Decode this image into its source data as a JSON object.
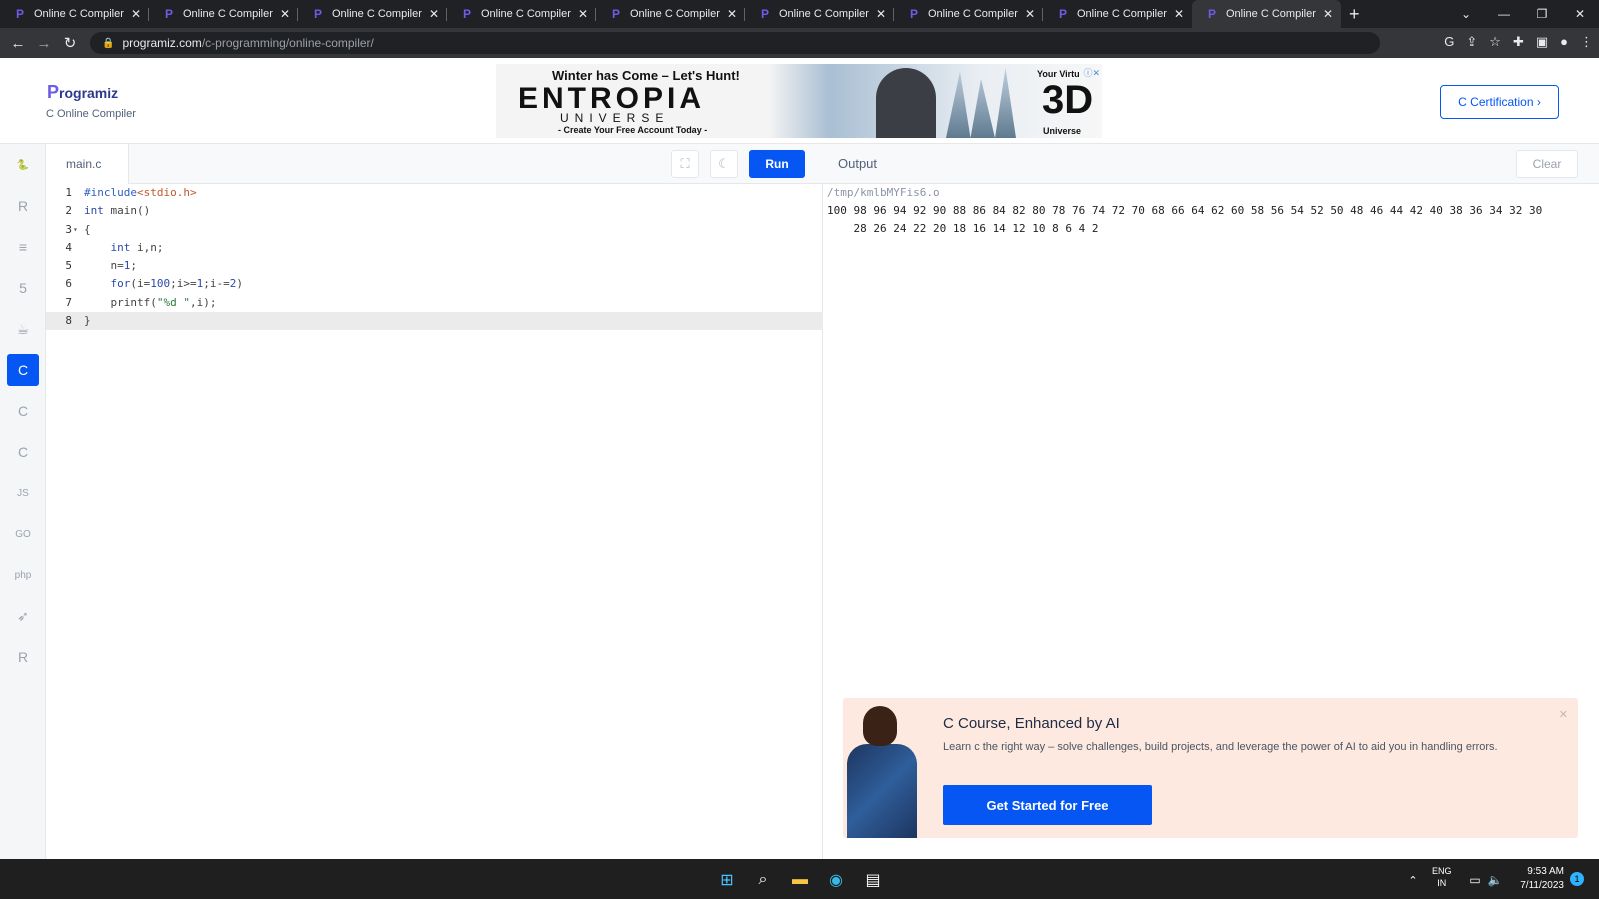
{
  "browser": {
    "tabs": [
      {
        "title": "Online C Compiler"
      },
      {
        "title": "Online C Compiler"
      },
      {
        "title": "Online C Compiler"
      },
      {
        "title": "Online C Compiler"
      },
      {
        "title": "Online C Compiler"
      },
      {
        "title": "Online C Compiler"
      },
      {
        "title": "Online C Compiler"
      },
      {
        "title": "Online C Compiler"
      },
      {
        "title": "Online C Compiler",
        "active": true
      }
    ],
    "url_host": "programiz.com",
    "url_path": "/c-programming/online-compiler/"
  },
  "header": {
    "logo": "rogramiz",
    "logo_initial": "P",
    "subtitle": "C Online Compiler",
    "cert_button": "C Certification ›"
  },
  "ad": {
    "line1": "Winter has Come – Let's Hunt!",
    "brand": "ENTROPIA",
    "brand_sub": "UNIVERSE",
    "cta": "- Create Your Free Account Today -",
    "right_top": "Your Virtu",
    "right_big": "3D",
    "right_bottom": "Universe"
  },
  "sidebar": {
    "languages": [
      {
        "icon": "python-icon",
        "glyph": "🐍",
        "active": false
      },
      {
        "icon": "r-icon",
        "glyph": "R",
        "active": false
      },
      {
        "icon": "sql-icon",
        "glyph": "≡",
        "active": false
      },
      {
        "icon": "html-icon",
        "glyph": "5",
        "active": false
      },
      {
        "icon": "java-icon",
        "glyph": "☕",
        "active": false
      },
      {
        "icon": "c-icon",
        "glyph": "C",
        "active": true
      },
      {
        "icon": "cpp-icon",
        "glyph": "C",
        "active": false
      },
      {
        "icon": "csharp-icon",
        "glyph": "C",
        "active": false
      },
      {
        "icon": "js-icon",
        "glyph": "JS",
        "active": false
      },
      {
        "icon": "go-icon",
        "glyph": "GO",
        "active": false
      },
      {
        "icon": "php-icon",
        "glyph": "php",
        "active": false
      },
      {
        "icon": "swift-icon",
        "glyph": "➶",
        "active": false
      },
      {
        "icon": "rust-icon",
        "glyph": "R",
        "active": false
      }
    ]
  },
  "editor": {
    "filename": "main.c",
    "run_label": "Run",
    "lines": [
      {
        "n": "1",
        "fold": "",
        "tokens": [
          {
            "c": "k-pre",
            "t": "#include"
          },
          {
            "c": "k-inc",
            "t": "<stdio.h>"
          }
        ]
      },
      {
        "n": "2",
        "fold": "",
        "tokens": [
          {
            "c": "k-type",
            "t": "int"
          },
          {
            "c": "k-plain",
            "t": " main()"
          }
        ]
      },
      {
        "n": "3",
        "fold": "▾",
        "tokens": [
          {
            "c": "k-plain",
            "t": "{"
          }
        ]
      },
      {
        "n": "4",
        "fold": "",
        "tokens": [
          {
            "c": "k-plain",
            "t": "    "
          },
          {
            "c": "k-type",
            "t": "int"
          },
          {
            "c": "k-plain",
            "t": " i,n;"
          }
        ]
      },
      {
        "n": "5",
        "fold": "",
        "tokens": [
          {
            "c": "k-plain",
            "t": "    n="
          },
          {
            "c": "k-num",
            "t": "1"
          },
          {
            "c": "k-plain",
            "t": ";"
          }
        ]
      },
      {
        "n": "6",
        "fold": "",
        "tokens": [
          {
            "c": "k-plain",
            "t": "    "
          },
          {
            "c": "k-type",
            "t": "for"
          },
          {
            "c": "k-plain",
            "t": "(i="
          },
          {
            "c": "k-num",
            "t": "100"
          },
          {
            "c": "k-plain",
            "t": ";i>="
          },
          {
            "c": "k-num",
            "t": "1"
          },
          {
            "c": "k-plain",
            "t": ";i-="
          },
          {
            "c": "k-num",
            "t": "2"
          },
          {
            "c": "k-plain",
            "t": ")"
          }
        ]
      },
      {
        "n": "7",
        "fold": "",
        "tokens": [
          {
            "c": "k-plain",
            "t": "    printf("
          },
          {
            "c": "k-str",
            "t": "\"%d \""
          },
          {
            "c": "k-plain",
            "t": ",i);"
          }
        ]
      },
      {
        "n": "8",
        "fold": "",
        "tokens": [
          {
            "c": "k-plain",
            "t": "}"
          }
        ],
        "highlight": true
      }
    ]
  },
  "output": {
    "title": "Output",
    "clear_label": "Clear",
    "path": "/tmp/kmlbMYFis6.o",
    "line1": "100 98 96 94 92 90 88 86 84 82 80 78 76 74 72 70 68 66 64 62 60 58 56 54 52 50 48 46 44 42 40 38 36 34 32 30",
    "line2": "    28 26 24 22 20 18 16 14 12 10 8 6 4 2"
  },
  "promo": {
    "title": "C Course, Enhanced by AI",
    "description": "Learn c the right way – solve challenges, build projects, and leverage the power of AI to aid you in handling errors.",
    "button": "Get Started for Free"
  },
  "taskbar": {
    "lang_top": "ENG",
    "lang_bottom": "IN",
    "time": "9:53 AM",
    "date": "7/11/2023",
    "notifications": "1"
  }
}
